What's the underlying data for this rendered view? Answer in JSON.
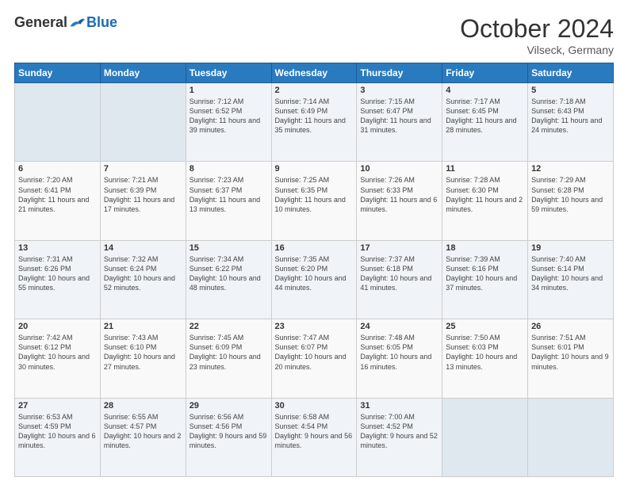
{
  "header": {
    "logo_general": "General",
    "logo_blue": "Blue",
    "month": "October 2024",
    "location": "Vilseck, Germany"
  },
  "weekdays": [
    "Sunday",
    "Monday",
    "Tuesday",
    "Wednesday",
    "Thursday",
    "Friday",
    "Saturday"
  ],
  "weeks": [
    [
      {
        "day": "",
        "info": ""
      },
      {
        "day": "",
        "info": ""
      },
      {
        "day": "1",
        "info": "Sunrise: 7:12 AM\nSunset: 6:52 PM\nDaylight: 11 hours and 39 minutes."
      },
      {
        "day": "2",
        "info": "Sunrise: 7:14 AM\nSunset: 6:49 PM\nDaylight: 11 hours and 35 minutes."
      },
      {
        "day": "3",
        "info": "Sunrise: 7:15 AM\nSunset: 6:47 PM\nDaylight: 11 hours and 31 minutes."
      },
      {
        "day": "4",
        "info": "Sunrise: 7:17 AM\nSunset: 6:45 PM\nDaylight: 11 hours and 28 minutes."
      },
      {
        "day": "5",
        "info": "Sunrise: 7:18 AM\nSunset: 6:43 PM\nDaylight: 11 hours and 24 minutes."
      }
    ],
    [
      {
        "day": "6",
        "info": "Sunrise: 7:20 AM\nSunset: 6:41 PM\nDaylight: 11 hours and 21 minutes."
      },
      {
        "day": "7",
        "info": "Sunrise: 7:21 AM\nSunset: 6:39 PM\nDaylight: 11 hours and 17 minutes."
      },
      {
        "day": "8",
        "info": "Sunrise: 7:23 AM\nSunset: 6:37 PM\nDaylight: 11 hours and 13 minutes."
      },
      {
        "day": "9",
        "info": "Sunrise: 7:25 AM\nSunset: 6:35 PM\nDaylight: 11 hours and 10 minutes."
      },
      {
        "day": "10",
        "info": "Sunrise: 7:26 AM\nSunset: 6:33 PM\nDaylight: 11 hours and 6 minutes."
      },
      {
        "day": "11",
        "info": "Sunrise: 7:28 AM\nSunset: 6:30 PM\nDaylight: 11 hours and 2 minutes."
      },
      {
        "day": "12",
        "info": "Sunrise: 7:29 AM\nSunset: 6:28 PM\nDaylight: 10 hours and 59 minutes."
      }
    ],
    [
      {
        "day": "13",
        "info": "Sunrise: 7:31 AM\nSunset: 6:26 PM\nDaylight: 10 hours and 55 minutes."
      },
      {
        "day": "14",
        "info": "Sunrise: 7:32 AM\nSunset: 6:24 PM\nDaylight: 10 hours and 52 minutes."
      },
      {
        "day": "15",
        "info": "Sunrise: 7:34 AM\nSunset: 6:22 PM\nDaylight: 10 hours and 48 minutes."
      },
      {
        "day": "16",
        "info": "Sunrise: 7:35 AM\nSunset: 6:20 PM\nDaylight: 10 hours and 44 minutes."
      },
      {
        "day": "17",
        "info": "Sunrise: 7:37 AM\nSunset: 6:18 PM\nDaylight: 10 hours and 41 minutes."
      },
      {
        "day": "18",
        "info": "Sunrise: 7:39 AM\nSunset: 6:16 PM\nDaylight: 10 hours and 37 minutes."
      },
      {
        "day": "19",
        "info": "Sunrise: 7:40 AM\nSunset: 6:14 PM\nDaylight: 10 hours and 34 minutes."
      }
    ],
    [
      {
        "day": "20",
        "info": "Sunrise: 7:42 AM\nSunset: 6:12 PM\nDaylight: 10 hours and 30 minutes."
      },
      {
        "day": "21",
        "info": "Sunrise: 7:43 AM\nSunset: 6:10 PM\nDaylight: 10 hours and 27 minutes."
      },
      {
        "day": "22",
        "info": "Sunrise: 7:45 AM\nSunset: 6:09 PM\nDaylight: 10 hours and 23 minutes."
      },
      {
        "day": "23",
        "info": "Sunrise: 7:47 AM\nSunset: 6:07 PM\nDaylight: 10 hours and 20 minutes."
      },
      {
        "day": "24",
        "info": "Sunrise: 7:48 AM\nSunset: 6:05 PM\nDaylight: 10 hours and 16 minutes."
      },
      {
        "day": "25",
        "info": "Sunrise: 7:50 AM\nSunset: 6:03 PM\nDaylight: 10 hours and 13 minutes."
      },
      {
        "day": "26",
        "info": "Sunrise: 7:51 AM\nSunset: 6:01 PM\nDaylight: 10 hours and 9 minutes."
      }
    ],
    [
      {
        "day": "27",
        "info": "Sunrise: 6:53 AM\nSunset: 4:59 PM\nDaylight: 10 hours and 6 minutes."
      },
      {
        "day": "28",
        "info": "Sunrise: 6:55 AM\nSunset: 4:57 PM\nDaylight: 10 hours and 2 minutes."
      },
      {
        "day": "29",
        "info": "Sunrise: 6:56 AM\nSunset: 4:56 PM\nDaylight: 9 hours and 59 minutes."
      },
      {
        "day": "30",
        "info": "Sunrise: 6:58 AM\nSunset: 4:54 PM\nDaylight: 9 hours and 56 minutes."
      },
      {
        "day": "31",
        "info": "Sunrise: 7:00 AM\nSunset: 4:52 PM\nDaylight: 9 hours and 52 minutes."
      },
      {
        "day": "",
        "info": ""
      },
      {
        "day": "",
        "info": ""
      }
    ]
  ]
}
